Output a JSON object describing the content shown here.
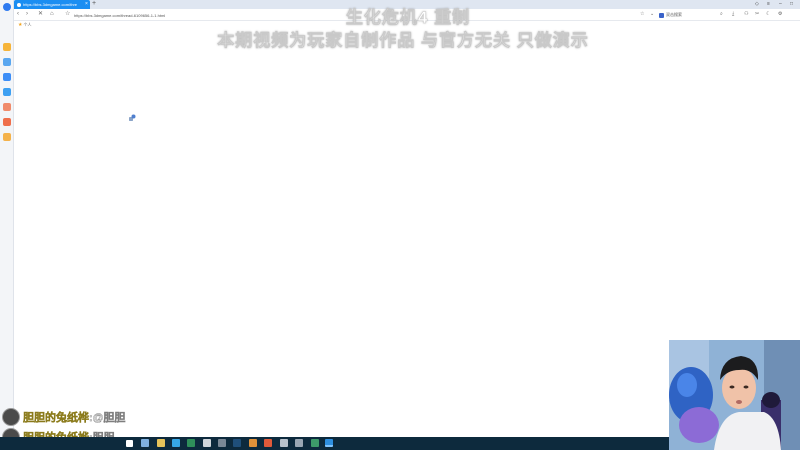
{
  "browser": {
    "active_tab_title": "https://bbs.3dmgame.com/thre",
    "new_tab_label": "+",
    "close_tab_label": "×",
    "url": "https://bbs.3dmgame.com/thread-6109656-1-1.html",
    "search_label": "双击搜索",
    "bookmark_label": "个人"
  },
  "overlay": {
    "line1": "生化危机4 重制",
    "line2": "本期视频为玩家自制作品 与官方无关 只做演示"
  },
  "chat": {
    "messages": [
      {
        "user": "胆胆的兔纸桦",
        "sep": ":",
        "text": "@胆胆"
      },
      {
        "user": "胆胆的兔纸桦",
        "sep": ":",
        "text": "胆胆"
      }
    ]
  },
  "colors": {
    "active_tab": "#1b8ef2",
    "tab_strip": "#dfe6f1",
    "taskbar": "#0d2a3d",
    "sidebar": "#f3f5f8",
    "chat_name": "#f4e36b"
  },
  "icons": {
    "sidebar": [
      "browser-logo-icon",
      "mail-icon",
      "cloud-icon",
      "translate-icon",
      "calendar-icon",
      "video-icon",
      "game-icon",
      "app-icon"
    ],
    "taskbar": [
      "start-icon",
      "search-icon",
      "task-view-icon",
      "file-explorer-icon",
      "edge-icon",
      "store-icon",
      "xbox-icon",
      "steam-icon",
      "chrome-icon",
      "app-icon",
      "obs-icon",
      "terminal-icon",
      "qq-browser-icon"
    ]
  }
}
